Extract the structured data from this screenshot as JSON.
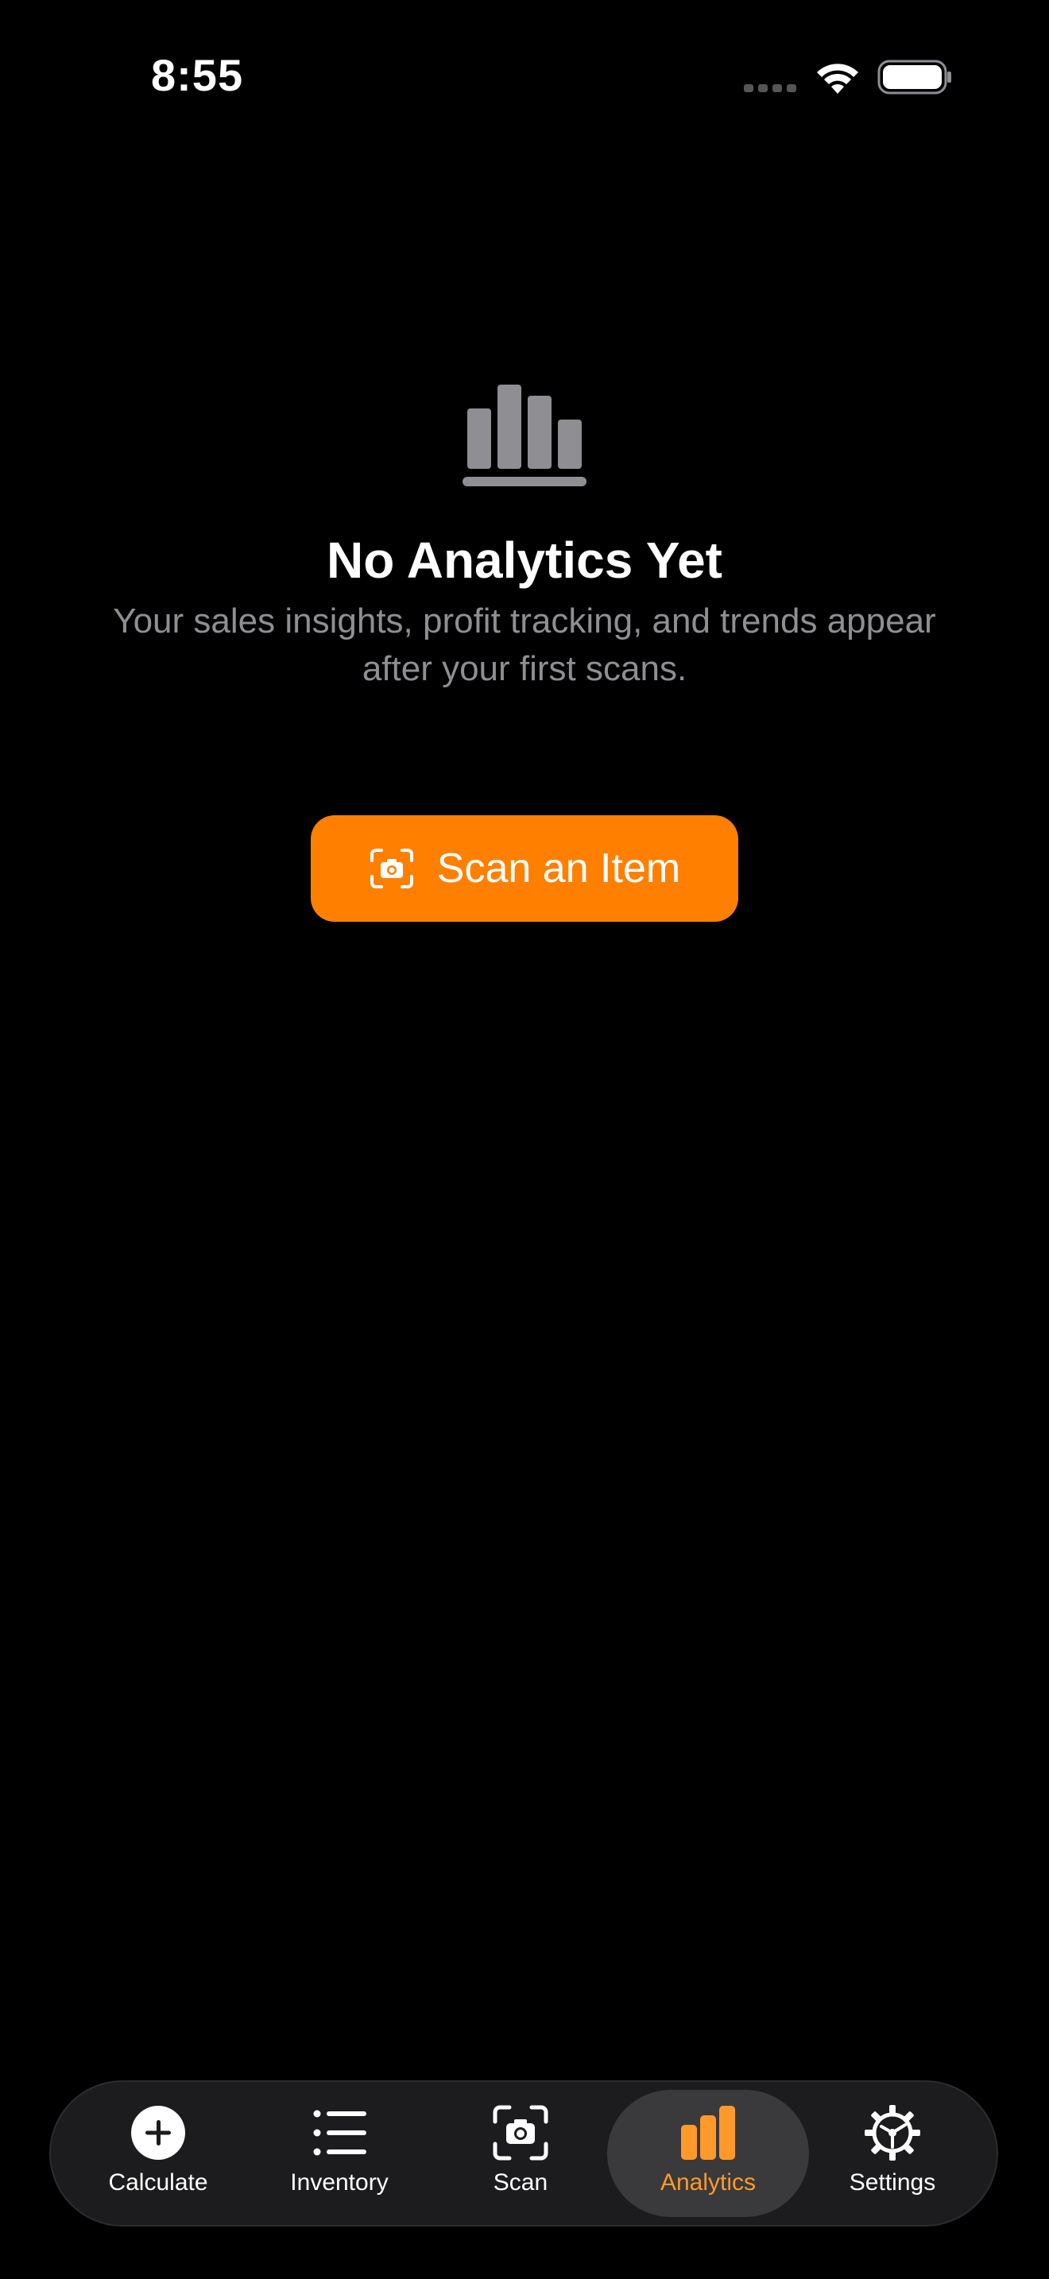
{
  "status_bar": {
    "time": "8:55"
  },
  "empty_state": {
    "icon": "chart-bar-icon",
    "title": "No Analytics Yet",
    "subtitle": "Your sales insights, profit tracking, and trends appear after your first scans."
  },
  "primary_action": {
    "label": "Scan an Item",
    "icon": "scan-camera-icon"
  },
  "tab_bar": {
    "tabs": [
      {
        "label": "Calculate",
        "icon": "plus-circle-icon",
        "selected": false
      },
      {
        "label": "Inventory",
        "icon": "list-icon",
        "selected": false
      },
      {
        "label": "Scan",
        "icon": "camera-scan-icon",
        "selected": false
      },
      {
        "label": "Analytics",
        "icon": "chart-bar-icon",
        "selected": true
      },
      {
        "label": "Settings",
        "icon": "gear-icon",
        "selected": false
      }
    ]
  },
  "colors": {
    "accent": "#ff8000",
    "active_tab_text": "#ff9a2a",
    "background": "#000000",
    "secondary_text": "#8e8e93",
    "empty_icon": "#8e8e93"
  }
}
